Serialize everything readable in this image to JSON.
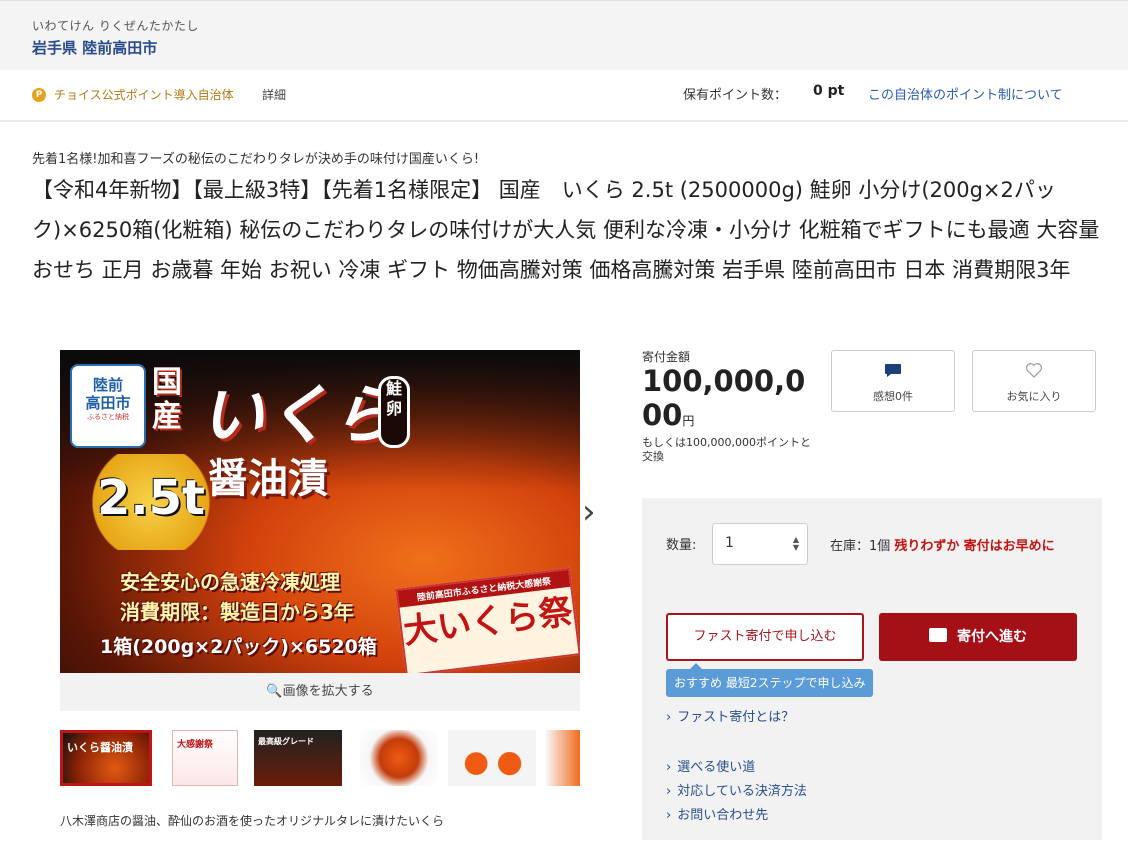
{
  "header": {
    "municipality_kana": "いわてけん りくぜんたかたし",
    "municipality": "岩手県 陸前高田市"
  },
  "pointbar": {
    "badge": "P",
    "choice_point_text": "チョイス公式ポイント導入自治体",
    "detail_link": "詳細",
    "holding_label": "保有ポイント数：",
    "holding_value": "0 pt",
    "policy_link": "この自治体のポイント制について"
  },
  "product": {
    "catchphrase": "先着1名様!加和喜フーズの秘伝のこだわりタレが決め手の味付け国産いくら!",
    "title": "【令和4年新物】【最上級3特】【先着1名様限定】 国産　いくら 2.5t (2500000g) 鮭卵 小分け(200g×2パック)×6250箱(化粧箱) 秘伝のこだわりタレの味付けが大人気 便利な冷凍・小分け 化粧箱でギフトにも最適 大容量 おせち 正月 お歳暮 年始 お祝い 冷凍 ギフト 物価高騰対策 価格高騰対策 岩手県 陸前高田市 日本 消費期限3年"
  },
  "gallery": {
    "main_image": {
      "logo_line1": "陸前",
      "logo_line2": "高田市",
      "logo_sub": "ふるさと納税",
      "kokusan": "国産",
      "ikura": "いくら",
      "sake_roe": "鮭卵",
      "shoyuzuke": "醤油漬",
      "amount": "2.5t",
      "line1": "安全安心の急速冷凍処理",
      "line2": "消費期限：製造日から3年",
      "line3": "1箱(200g×2パック)×6520箱",
      "festival_banner": "陸前高田市ふるさと納税大感謝祭",
      "festival_title": "大いくら祭"
    },
    "next_arrow": "›",
    "zoom_label": "🔍画像を拡大する",
    "thumbnails": [
      {
        "label": "いくら醤油漬"
      },
      {
        "label": "大感謝祭"
      },
      {
        "label": "最高級グレード"
      },
      {
        "label": ""
      },
      {
        "label": ""
      },
      {
        "label": ""
      }
    ],
    "caption": "八木澤商店の醤油、酔仙のお酒を使ったオリジナルタレに漬けたいくら"
  },
  "donation": {
    "label": "寄付金額",
    "amount": "100,000,000",
    "unit": "円",
    "points_alt": "もしくは100,000,000ポイントと交換"
  },
  "cards": {
    "reviews_icon": "comment-icon",
    "reviews_label": "感想0件",
    "favorite_icon": "heart-icon",
    "favorite_label": "お気に入り"
  },
  "order": {
    "qty_label": "数量:",
    "qty_value": "1",
    "stock_label": "在庫：1個",
    "stock_warning": "残りわずか",
    "stock_cta": "寄付はお早めに",
    "fast_button": "ファスト寄付で申し込む",
    "go_button": "寄付へ進む",
    "tip": "おすすめ 最短2ステップで申し込み",
    "links": [
      "ファスト寄付とは？",
      "選べる使い道",
      "対応している決済方法",
      "お問い合わせ先"
    ]
  },
  "colors": {
    "accent_red": "#a50f16",
    "link_blue": "#2a4f8c",
    "tip_blue": "#5a9bd8",
    "point_orange": "#e6a21a"
  }
}
